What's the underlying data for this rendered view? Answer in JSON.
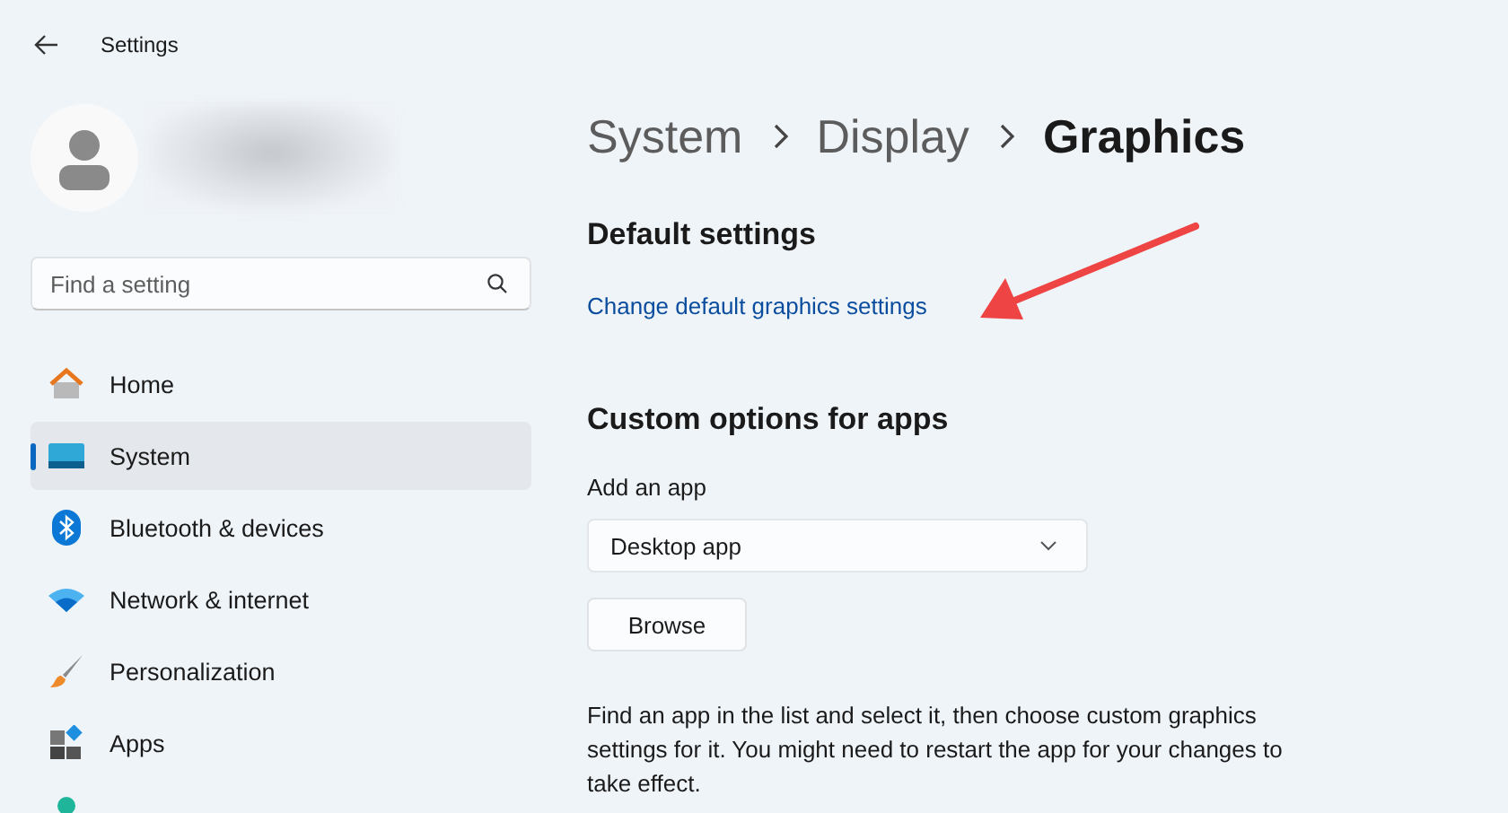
{
  "window": {
    "title": "Settings"
  },
  "sidebar": {
    "search": {
      "placeholder": "Find a setting"
    },
    "items": [
      {
        "kind": "home",
        "label": "Home",
        "selected": false
      },
      {
        "kind": "system",
        "label": "System",
        "selected": true
      },
      {
        "kind": "bluetooth",
        "label": "Bluetooth & devices",
        "selected": false
      },
      {
        "kind": "network",
        "label": "Network & internet",
        "selected": false
      },
      {
        "kind": "personalization",
        "label": "Personalization",
        "selected": false
      },
      {
        "kind": "apps",
        "label": "Apps",
        "selected": false
      },
      {
        "kind": "accounts",
        "selected": false
      }
    ]
  },
  "breadcrumb": [
    {
      "label": "System",
      "current": false
    },
    {
      "label": "Display",
      "current": false
    },
    {
      "label": "Graphics",
      "current": true
    }
  ],
  "default_settings": {
    "heading": "Default settings",
    "link": "Change default graphics settings"
  },
  "custom_options": {
    "heading": "Custom options for apps",
    "add_label": "Add an app",
    "dropdown": {
      "value": "Desktop app"
    },
    "browse_button": "Browse",
    "description": "Find an app in the list and select it, then choose custom graphics settings for it. You might need to restart the app for your changes to take effect."
  }
}
